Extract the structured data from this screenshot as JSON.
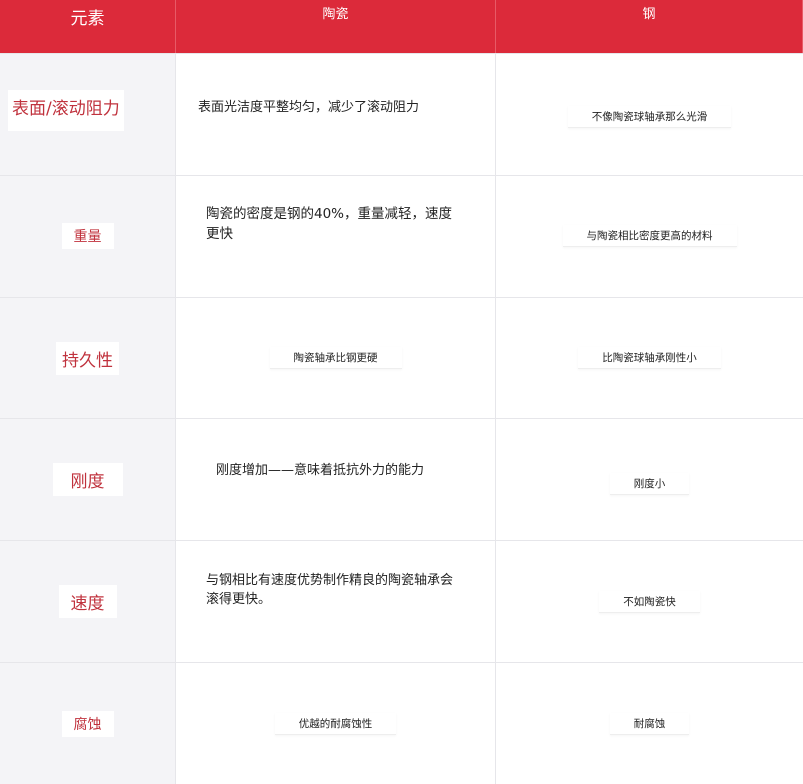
{
  "header": {
    "col1": "元素",
    "col2": "陶瓷",
    "col3": "钢"
  },
  "rows": [
    {
      "element": "表面/滚动阻力",
      "ceramic": "表面光洁度平整均匀，减少了滚动阻力",
      "steel": "不像陶瓷球轴承那么光滑"
    },
    {
      "element": "重量",
      "ceramic": "陶瓷的密度是钢的40%，重量减轻，速度更快",
      "steel": "与陶瓷相比密度更高的材料"
    },
    {
      "element": "持久性",
      "ceramic": "陶瓷轴承比钢更硬",
      "steel": "比陶瓷球轴承刚性小"
    },
    {
      "element": "刚度",
      "ceramic": "刚度增加——意味着抵抗外力的能力",
      "steel": "刚度小"
    },
    {
      "element": "速度",
      "ceramic": "与钢相比有速度优势制作精良的陶瓷轴承会滚得更快。",
      "steel": "不如陶瓷快"
    },
    {
      "element": "腐蚀",
      "ceramic": "优越的耐腐蚀性",
      "steel": "耐腐蚀"
    }
  ],
  "colors": {
    "header_bg": "#dc2a3a",
    "row_label": "#c0323d",
    "label_col_bg": "#f4f4f7"
  }
}
